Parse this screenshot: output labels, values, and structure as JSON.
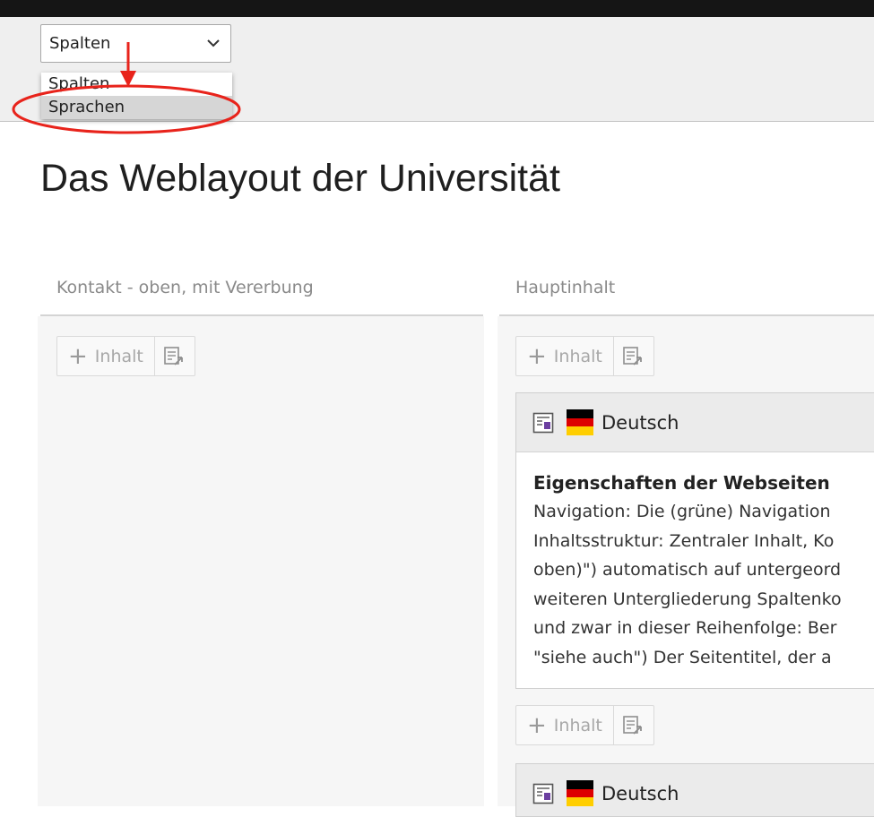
{
  "toolbar": {
    "view_select": {
      "value": "Spalten",
      "options": [
        "Spalten",
        "Sprachen"
      ],
      "highlighted": "Sprachen"
    }
  },
  "page": {
    "title": "Das Weblayout der Universität"
  },
  "columns": {
    "left": {
      "header": "Kontakt - oben, mit Vererbung",
      "new_button": "Inhalt"
    },
    "right": {
      "header": "Hauptinhalt",
      "new_button": "Inhalt",
      "elements": [
        {
          "language": "Deutsch",
          "title": "Eigenschaften der Webseiten",
          "lines": [
            "Navigation: Die (grüne) Navigation",
            "Inhaltsstruktur: Zentraler Inhalt, Ko",
            "oben)\") automatisch auf untergeord",
            "weiteren Untergliederung Spaltenko",
            "und zwar in dieser Reihenfolge: Ber",
            "\"siehe auch\") Der Seitentitel, der a"
          ]
        },
        {
          "language": "Deutsch"
        }
      ]
    }
  },
  "icons": {
    "chevron": "chevron-down-icon",
    "plus": "plus-icon",
    "paste": "paste-icon",
    "content_type": "content-element-icon",
    "flag": "flag-de-icon"
  },
  "colors": {
    "annotation_red": "#e8231b",
    "flag_de": [
      "#000000",
      "#dd0000",
      "#ffce00"
    ],
    "topbar": "#151515",
    "toolbar": "#efefef"
  }
}
